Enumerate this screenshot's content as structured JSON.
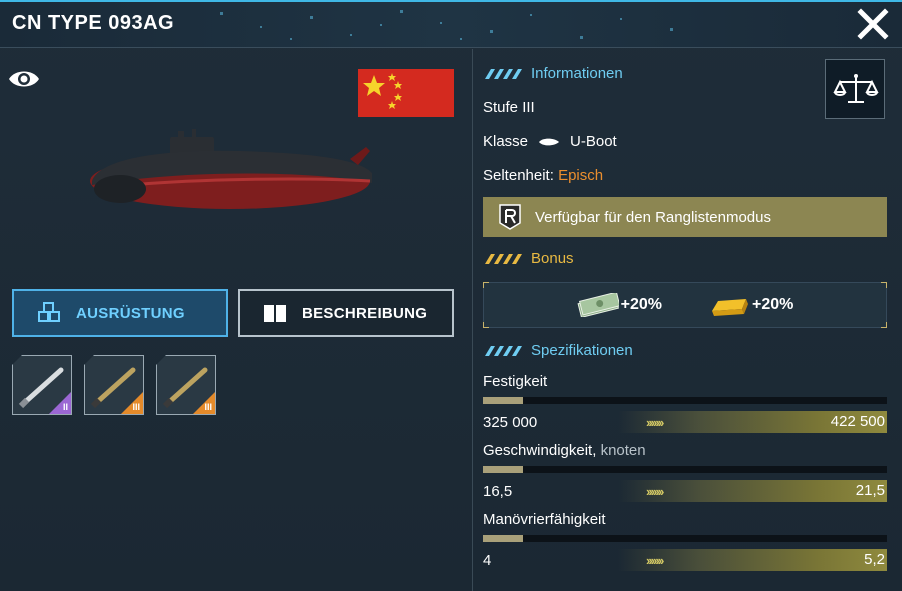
{
  "header": {
    "title": "CN TYPE 093AG"
  },
  "left": {
    "tabs": [
      {
        "label": "AUSRÜSTUNG",
        "active": true
      },
      {
        "label": "BESCHREIBUNG",
        "active": false
      }
    ],
    "equipment": [
      {
        "icon": "missile-icon",
        "rarity_color": "#9b67d4",
        "level": "II"
      },
      {
        "icon": "torpedo-icon",
        "rarity_color": "#e48a2a",
        "level": "III"
      },
      {
        "icon": "torpedo-icon",
        "rarity_color": "#e48a2a",
        "level": "III"
      }
    ]
  },
  "info": {
    "section_title": "Informationen",
    "stufe_label": "Stufe",
    "stufe_value": "III",
    "klasse_label": "Klasse",
    "klasse_value": "U-Boot",
    "seltenheit_label": "Seltenheit:",
    "seltenheit_value": "Episch",
    "ranked_label": "Verfügbar für den Ranglistenmodus"
  },
  "bonus": {
    "section_title": "Bonus",
    "items": [
      {
        "icon": "money-icon",
        "value": "+20%"
      },
      {
        "icon": "gold-bar-icon",
        "value": "+20%"
      }
    ]
  },
  "specs": {
    "section_title": "Spezifikationen",
    "stats": [
      {
        "label": "Festigkeit",
        "unit": "",
        "base": "325 000",
        "max": "422 500",
        "fill": 0.1
      },
      {
        "label": "Geschwindigkeit,",
        "unit": "knoten",
        "base": "16,5",
        "max": "21,5",
        "fill": 0.1
      },
      {
        "label": "Manövrierfähigkeit",
        "unit": "",
        "base": "4",
        "max": "5,2",
        "fill": 0.1
      }
    ]
  },
  "colors": {
    "accent": "#3fb8e6",
    "epic": "#eb8f2e",
    "bonus": "#e8b942",
    "ranked_bg": "#8c8652"
  }
}
